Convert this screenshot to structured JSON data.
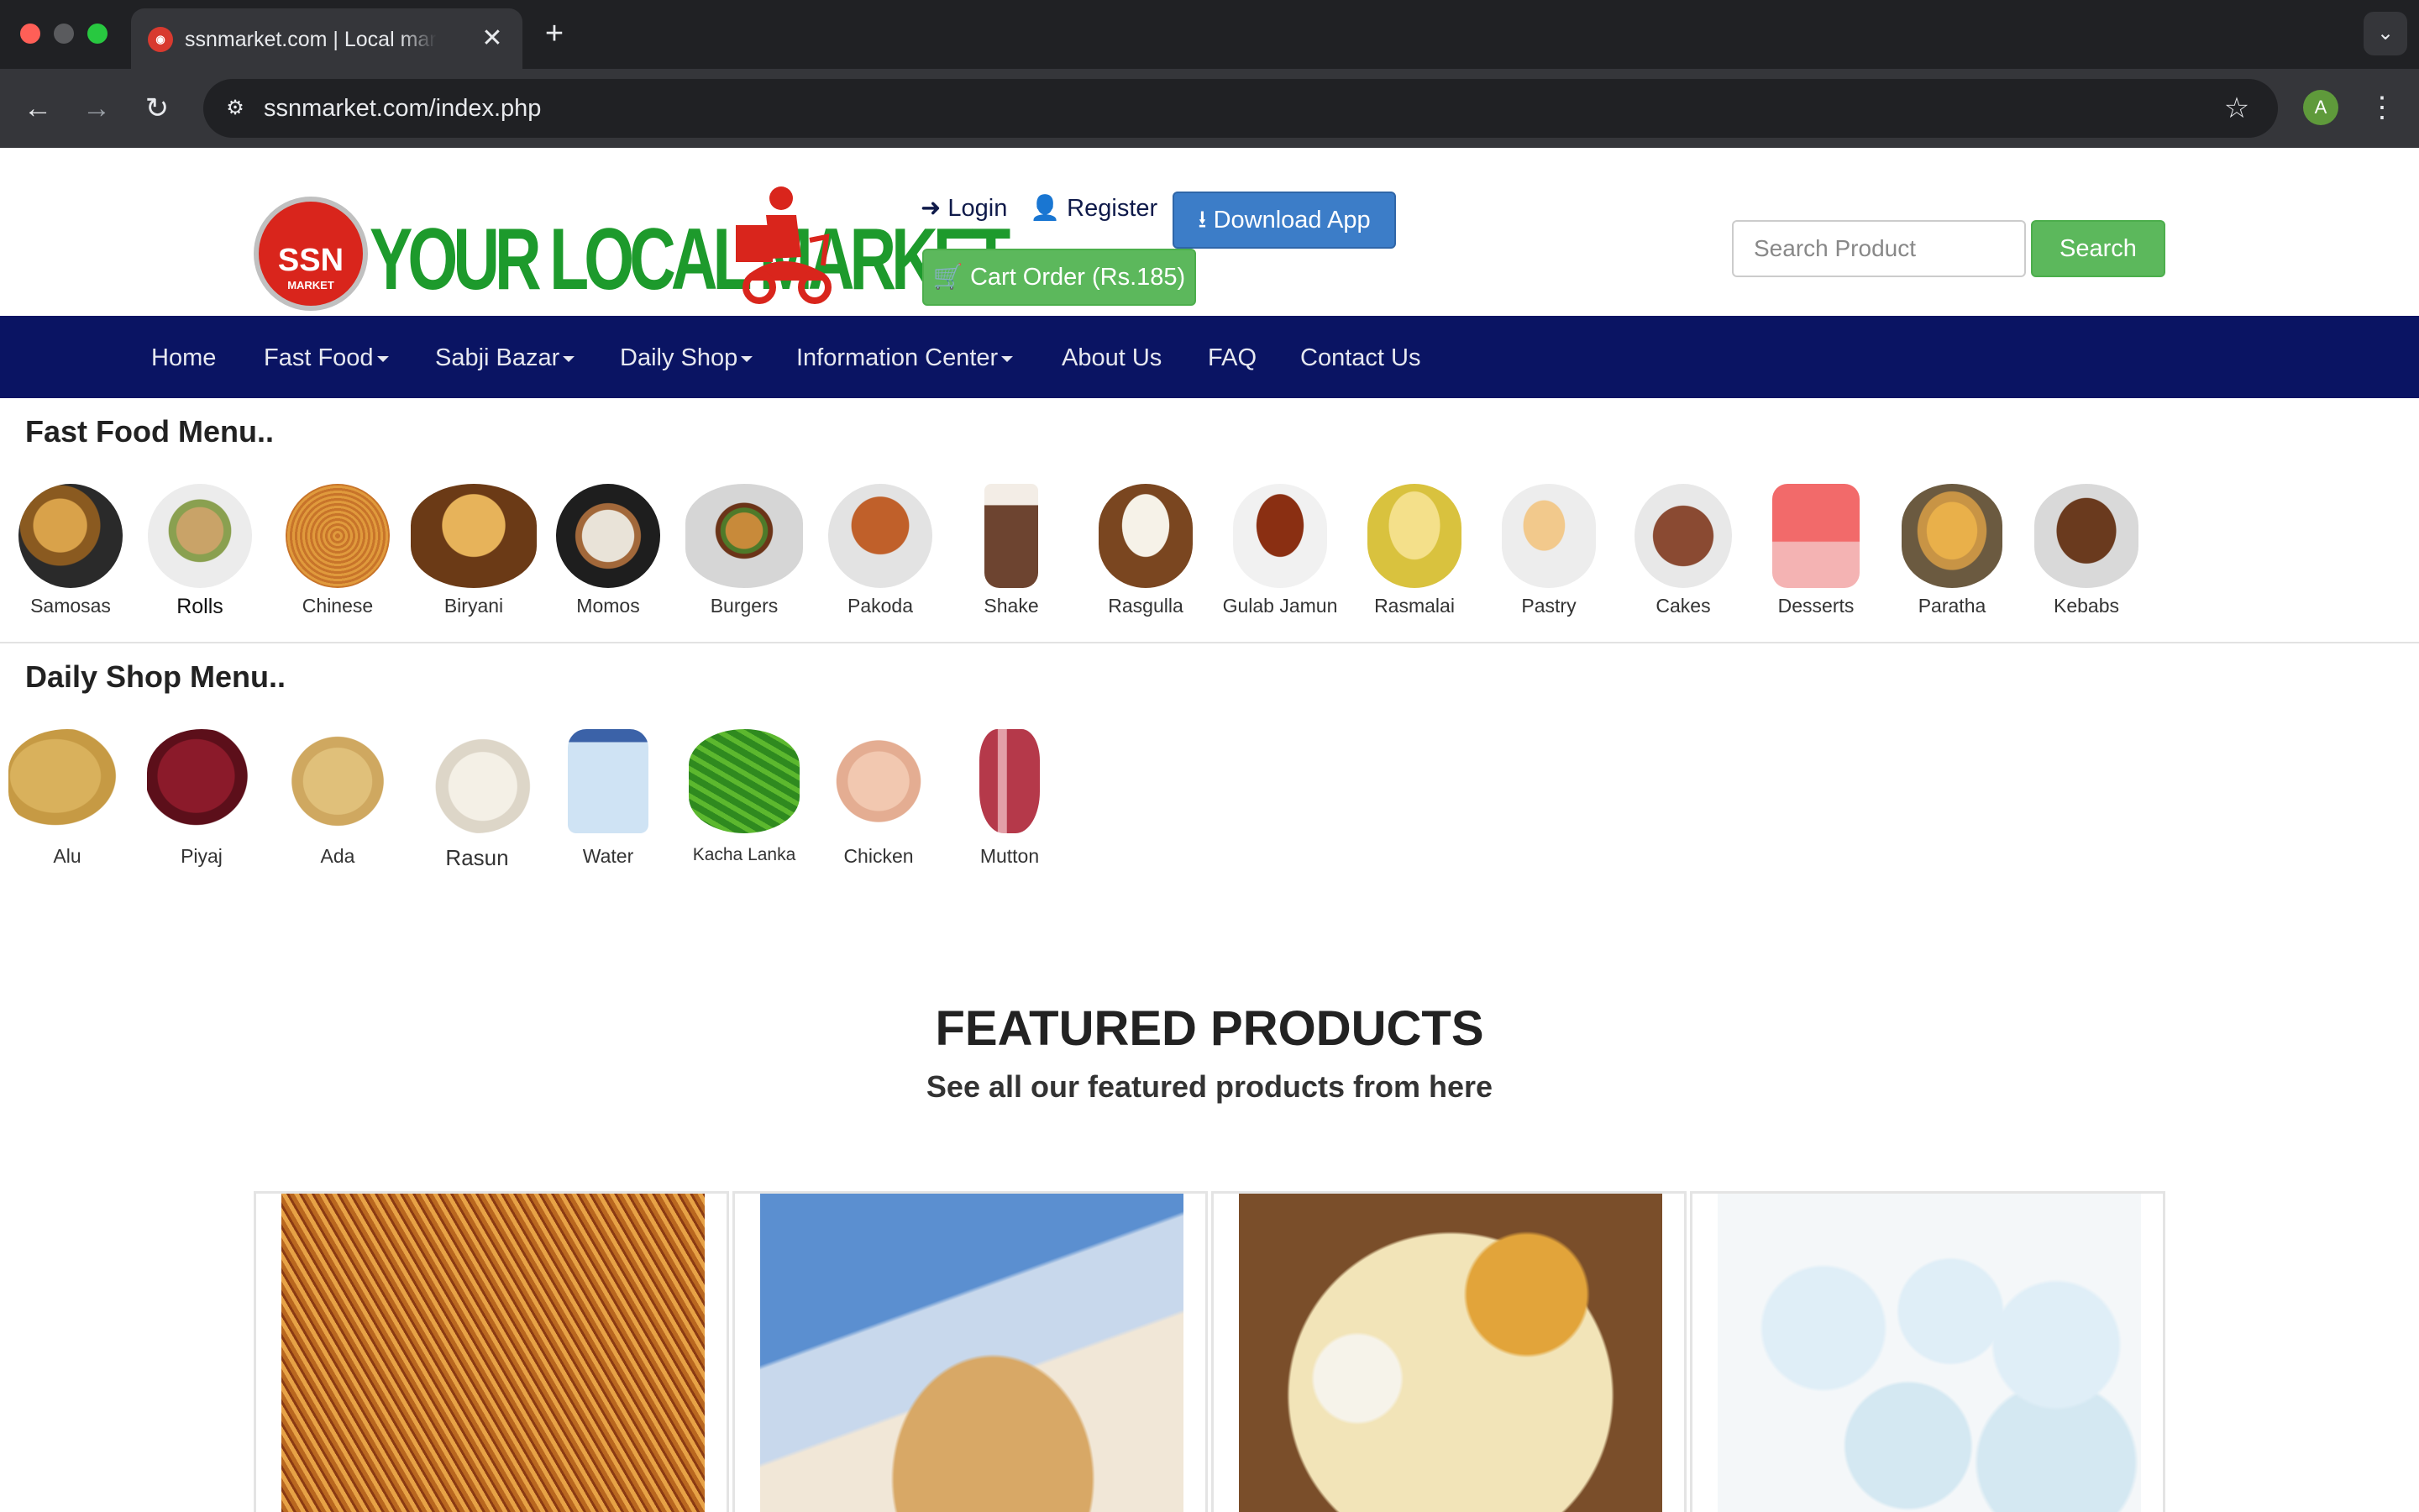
{
  "browser": {
    "tab_title": "ssnmarket.com | Local market",
    "tab_favicon": "ssn-favicon",
    "new_tab": "+",
    "close": "✕",
    "url": "ssnmarket.com/index.php",
    "profile_initial": "A",
    "icons": [
      "back-icon",
      "forward-icon",
      "reload-icon",
      "site-info-icon",
      "star-icon",
      "kebab-menu-icon",
      "tab-list-icon"
    ]
  },
  "header": {
    "logo": {
      "ssn": "SSN",
      "market": "MARKET",
      "tagline": "YOUR LOCAL MARKET"
    },
    "login": "Login",
    "register": "Register",
    "download_app": "Download App",
    "cart": "Cart Order (Rs.185)",
    "search_placeholder": "Search Product",
    "search_button": "Search"
  },
  "nav": {
    "items": [
      {
        "label": "Home",
        "dropdown": false
      },
      {
        "label": "Fast Food",
        "dropdown": true
      },
      {
        "label": "Sabji Bazar",
        "dropdown": true
      },
      {
        "label": "Daily Shop",
        "dropdown": true
      },
      {
        "label": "Information Center",
        "dropdown": true
      },
      {
        "label": "About Us",
        "dropdown": false
      },
      {
        "label": "FAQ",
        "dropdown": false
      },
      {
        "label": "Contact Us",
        "dropdown": false
      }
    ]
  },
  "fast_food": {
    "title": "Fast Food Menu..",
    "items": [
      "Samosas",
      "Rolls",
      "Chinese",
      "Biryani",
      "Momos",
      "Burgers",
      "Pakoda",
      "Shake",
      "Rasgulla",
      "Gulab Jamun",
      "Rasmalai",
      "Pastry",
      "Cakes",
      "Desserts",
      "Paratha",
      "Kebabs"
    ]
  },
  "daily_shop": {
    "title": "Daily Shop Menu..",
    "items": [
      "Alu",
      "Piyaj",
      "Ada",
      "Rasun",
      "Water",
      "Kacha Lanka",
      "Chicken",
      "Mutton"
    ]
  },
  "featured": {
    "title": "FEATURED PRODUCTS",
    "subtitle": "See all our featured products from here"
  },
  "colors": {
    "navbar": "#0a1463",
    "green_button": "#5cb85c",
    "blue_button": "#3c7dc8",
    "logo_green": "#1d9a2c",
    "logo_red": "#d9251c"
  }
}
